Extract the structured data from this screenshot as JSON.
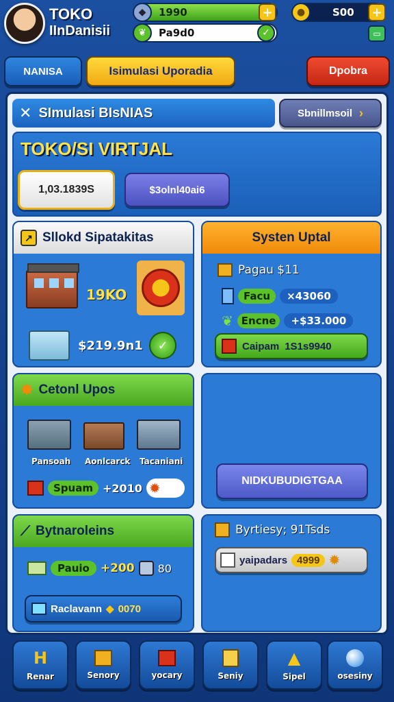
{
  "header": {
    "title_line1": "TOKO",
    "title_line2": "IInDanisii",
    "resource1_value": "1990",
    "resource1_plus": "+",
    "resource2_value": "Pa9d0",
    "resource2_check": "✓",
    "gold_value": "S00",
    "gold_plus": "+"
  },
  "top_buttons": {
    "left": "NANISA",
    "middle": "Isimulasi Uporadia",
    "right": "Dpobra"
  },
  "banner": {
    "title": "SImulasi BIsNIAS",
    "button": "Sbnillmsoil"
  },
  "store": {
    "name": "TOKO/SI VIRTJAL",
    "value_box": "1,03.1839S",
    "value_button": "$3olnl40ai6"
  },
  "card_stats": {
    "title": "Sllokd Sipatakitas",
    "count": "19KO",
    "money": "$219.9n1"
  },
  "card_system": {
    "title": "Systen Uptal",
    "line1": "Pagau $11",
    "row1_label": "Facu",
    "row1_value": "×43060",
    "row2_label": "Encne",
    "row2_value": "+$33.000",
    "highlight_label": "Caipam",
    "highlight_value": "1S1s9940"
  },
  "card_upgrades": {
    "title": "Cetonl Upos",
    "buildings": [
      "Pansoah",
      "Aonlcarck",
      "Tacaniani"
    ],
    "footer_label": "Spuam",
    "footer_value": "+2010"
  },
  "card_empty": {
    "button": "NIDKUBUDIGTGAA"
  },
  "card_business": {
    "title": "Bytnaroleins",
    "row1_label": "Pauio",
    "row1_value": "+200",
    "row1_count": "80",
    "row2_label": "Raclavann",
    "row2_value": "0070"
  },
  "card_bytes": {
    "title": "Byrtiesy; 91Tsds",
    "row_label": "yaipadars",
    "row_value": "4999"
  },
  "nav": [
    "Renar",
    "Senory",
    "yocary",
    "Seniy",
    "Sipel",
    "osesiny"
  ],
  "colors": {
    "green": "#5cc22c",
    "gold": "#f5c518",
    "orange": "#f59a12",
    "red": "#d93320",
    "blue_dark": "#0f3578",
    "purple_button": "#5b62d6"
  }
}
